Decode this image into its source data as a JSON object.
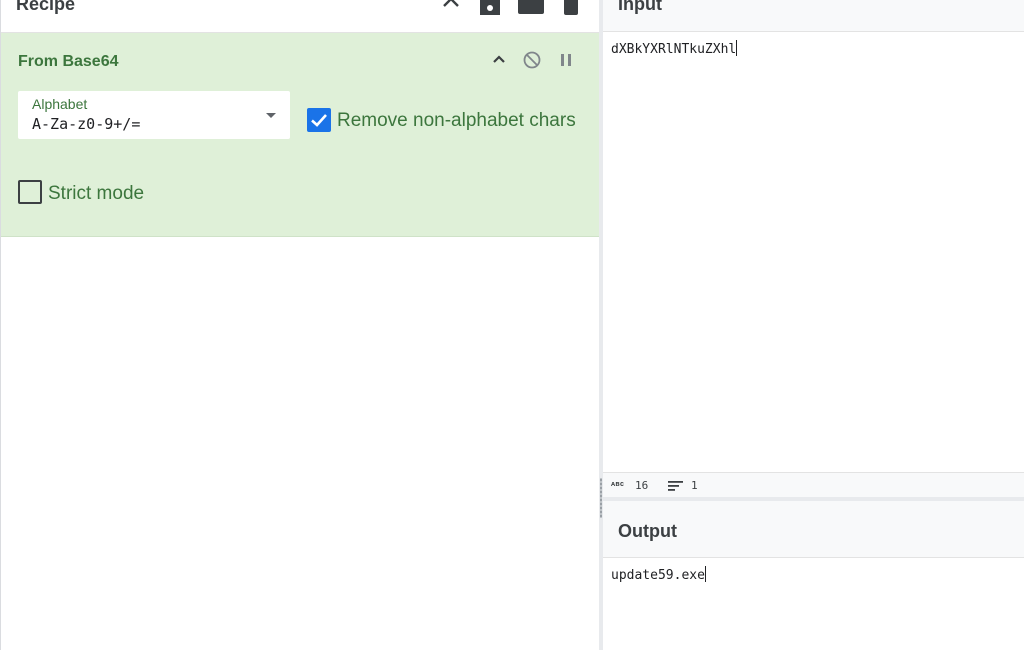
{
  "recipe": {
    "title": "Recipe",
    "operation": {
      "name": "From Base64",
      "alphabet_label": "Alphabet",
      "alphabet_value": "A-Za-z0-9+/=",
      "remove_non_alphabet_label": "Remove non-alphabet chars",
      "remove_non_alphabet_checked": true,
      "strict_mode_label": "Strict mode",
      "strict_mode_checked": false
    }
  },
  "input": {
    "title": "Input",
    "text": "dXBkYXRlNTkuZXhl",
    "stats": {
      "chars": "16",
      "lines": "1"
    }
  },
  "output": {
    "title": "Output",
    "text": "update59.exe"
  },
  "colors": {
    "operation_bg": "#dff0d8",
    "operation_text": "#3c763d",
    "checkbox_accent": "#1a73e8"
  }
}
